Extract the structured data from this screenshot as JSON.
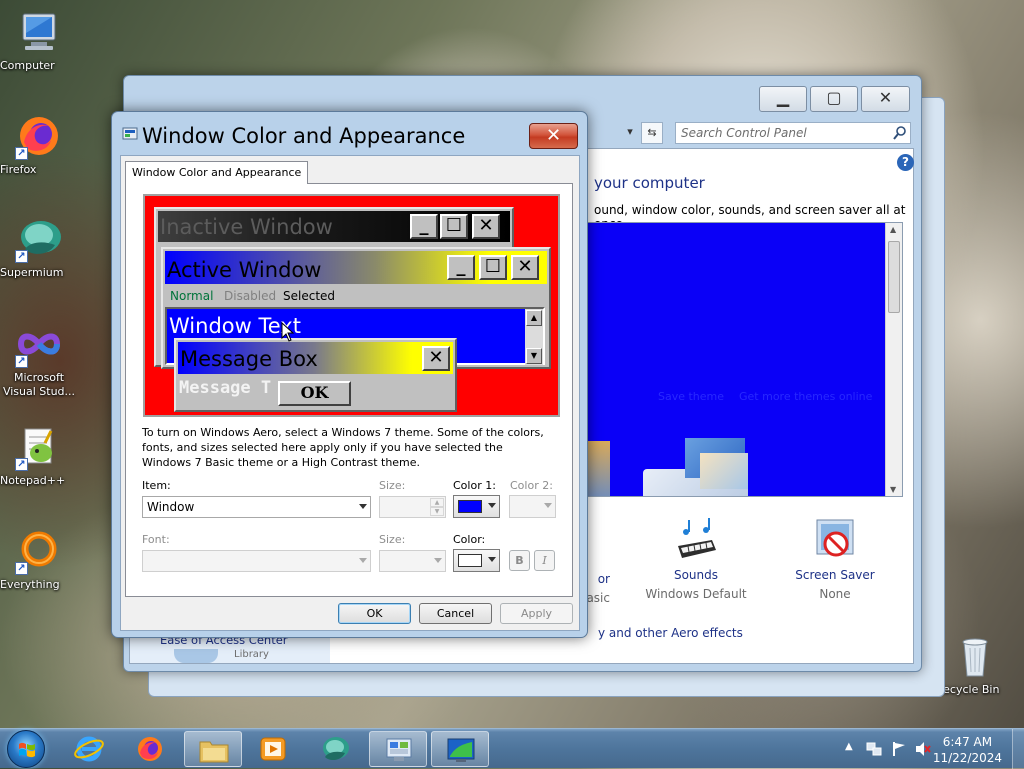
{
  "desktop": {
    "icons": [
      {
        "label": "Computer"
      },
      {
        "label": "Firefox"
      },
      {
        "label": "Supermium"
      },
      {
        "label": "Microsoft Visual Stud..."
      },
      {
        "label": "Notepad++"
      },
      {
        "label": "Everything"
      },
      {
        "label": "Recycle Bin"
      }
    ]
  },
  "control_panel": {
    "search_placeholder": "Search Control Panel",
    "heading": "your computer",
    "subheading": "ound, window color, sounds, and screen saver all at once.",
    "theme_links": [
      "Save theme",
      "Get more themes online"
    ],
    "items": [
      {
        "name": "or",
        "value": "asic"
      },
      {
        "name": "Sounds",
        "value": "Windows Default"
      },
      {
        "name": "Screen Saver",
        "value": "None"
      }
    ],
    "aero_link": "y and other Aero effects",
    "sidebar_link": "Ease of Access Center",
    "sidebar_link2": "Library"
  },
  "dialog": {
    "title": "Window Color and Appearance",
    "tab": "Window Color and Appearance",
    "preview": {
      "inactive_title": "Inactive Window",
      "active_title": "Active Window",
      "menu": [
        "Normal",
        "Disabled",
        "Selected"
      ],
      "window_text": "Window Text",
      "msgbox_title": "Message Box",
      "msgbox_text": "Message T",
      "ok": "OK"
    },
    "info": "To turn on Windows Aero, select a Windows 7 theme.  Some of the colors, fonts, and sizes selected here apply only if you have selected the Windows 7 Basic theme or a High Contrast theme.",
    "item_label": "Item:",
    "item_value": "Window",
    "size_label": "Size:",
    "color1_label": "Color 1:",
    "color2_label": "Color 2:",
    "font_label": "Font:",
    "size2_label": "Size:",
    "color_label": "Color:",
    "bold": "B",
    "italic": "I",
    "ok": "OK",
    "cancel": "Cancel",
    "apply": "Apply",
    "color1_value": "#0000ff",
    "color_value": "#ffffff"
  },
  "taskbar": {
    "time": "6:47 AM",
    "date": "11/22/2024"
  },
  "colors": {
    "preview_background": "#ff0000",
    "active_title_start": "#0000ff",
    "active_title_end": "#ffff00",
    "window_bg": "#0000ff"
  }
}
